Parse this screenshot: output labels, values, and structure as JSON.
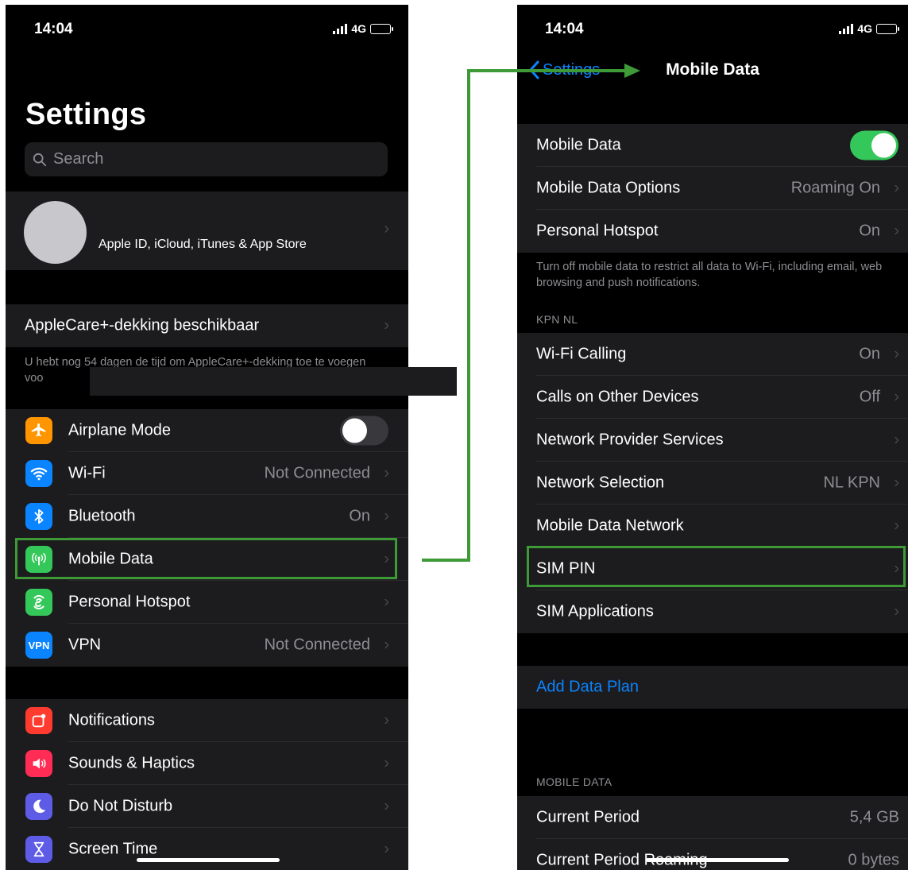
{
  "left": {
    "status": {
      "time": "14:04",
      "network": "4G"
    },
    "title": "Settings",
    "search_placeholder": "Search",
    "apple_id_label": "Apple ID, iCloud, iTunes & App Store",
    "applecare": {
      "label": "AppleCare+-dekking beschikbaar",
      "footer": "U hebt nog 54 dagen de tijd om AppleCare+-dekking toe te voegen voo"
    },
    "connectivity": [
      {
        "label": "Airplane Mode",
        "value": "",
        "icon": "airplane-icon",
        "color": "#ff9500"
      },
      {
        "label": "Wi-Fi",
        "value": "Not Connected",
        "icon": "wifi-icon",
        "color": "#0a84ff"
      },
      {
        "label": "Bluetooth",
        "value": "On",
        "icon": "bluetooth-icon",
        "color": "#0a84ff"
      },
      {
        "label": "Mobile Data",
        "value": "",
        "icon": "antenna-icon",
        "color": "#34c759"
      },
      {
        "label": "Personal Hotspot",
        "value": "",
        "icon": "hotspot-icon",
        "color": "#34c759"
      },
      {
        "label": "VPN",
        "value": "Not Connected",
        "icon": "vpn-icon",
        "icon_text": "VPN",
        "color": "#0a84ff"
      }
    ],
    "general": [
      {
        "label": "Notifications",
        "icon": "notifications-icon",
        "color": "#ff3b30"
      },
      {
        "label": "Sounds & Haptics",
        "icon": "speaker-icon",
        "color": "#ff2d55"
      },
      {
        "label": "Do Not Disturb",
        "icon": "moon-icon",
        "color": "#5e5ce6"
      },
      {
        "label": "Screen Time",
        "icon": "hourglass-icon",
        "color": "#5e5ce6"
      }
    ]
  },
  "right": {
    "status": {
      "time": "14:04",
      "network": "4G"
    },
    "nav": {
      "back": "Settings",
      "title": "Mobile Data"
    },
    "group1": [
      {
        "label": "Mobile Data",
        "value": "",
        "toggle": true
      },
      {
        "label": "Mobile Data Options",
        "value": "Roaming On"
      },
      {
        "label": "Personal Hotspot",
        "value": "On"
      }
    ],
    "footer1": "Turn off mobile data to restrict all data to Wi-Fi, including email, web browsing and push notifications.",
    "carrier_header": "KPN NL",
    "group2": [
      {
        "label": "Wi-Fi Calling",
        "value": "On"
      },
      {
        "label": "Calls on Other Devices",
        "value": "Off"
      },
      {
        "label": "Network Provider Services",
        "value": ""
      },
      {
        "label": "Network Selection",
        "value": "NL KPN"
      },
      {
        "label": "Mobile Data Network",
        "value": ""
      },
      {
        "label": "SIM PIN",
        "value": ""
      },
      {
        "label": "SIM Applications",
        "value": ""
      }
    ],
    "add_data_plan": "Add Data Plan",
    "usage_header": "MOBILE DATA",
    "usage": [
      {
        "label": "Current Period",
        "value": "5,4 GB"
      },
      {
        "label": "Current Period Roaming",
        "value": "0 bytes"
      }
    ]
  },
  "colors": {
    "highlight": "#3d9a36",
    "toggle_on": "#34c759",
    "link": "#0a84ff"
  }
}
